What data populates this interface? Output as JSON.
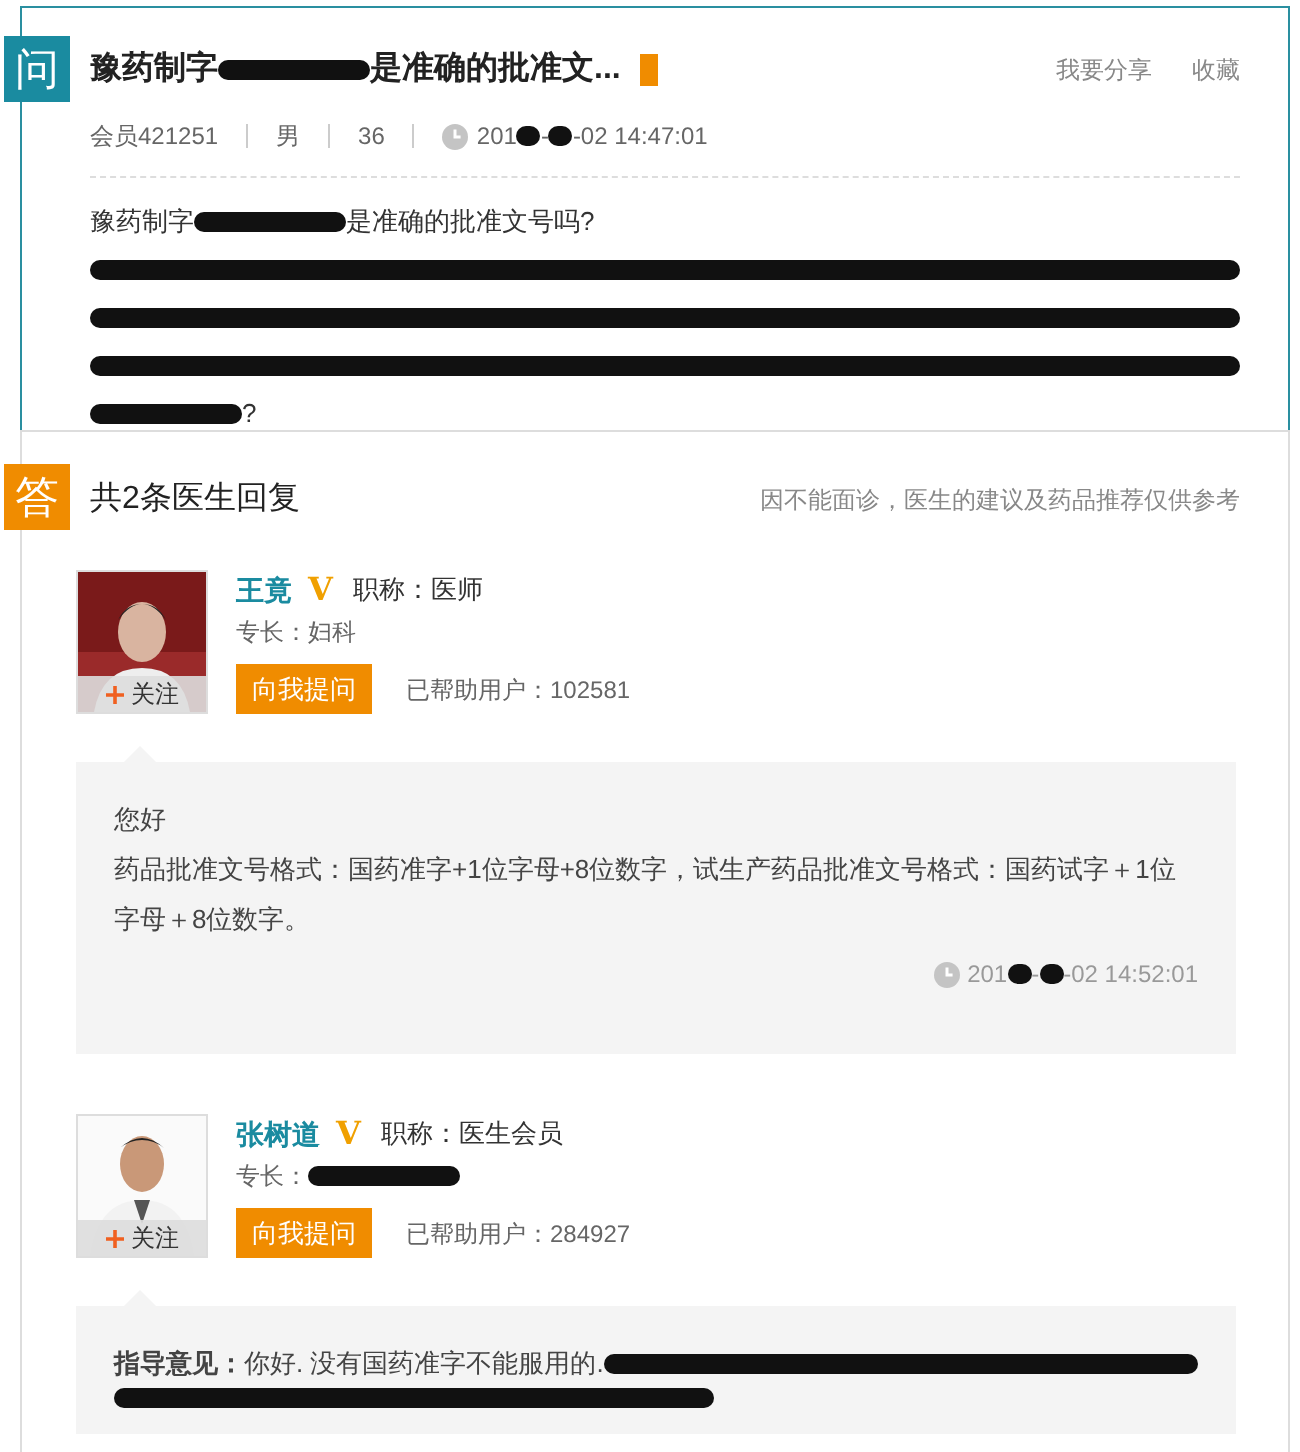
{
  "question": {
    "badge": "问",
    "title": [
      {
        "kind": "text",
        "text": "豫药制字"
      },
      {
        "kind": "scribble"
      },
      {
        "kind": "text",
        "text": "是准确的批准文..."
      }
    ],
    "actions": [
      "我要分享",
      "收藏"
    ],
    "meta": [
      "会员421251",
      "男",
      "36"
    ],
    "time": [
      {
        "kind": "text",
        "text": "201"
      },
      {
        "kind": "blot"
      },
      {
        "kind": "text",
        "text": "-"
      },
      {
        "kind": "blot"
      },
      {
        "kind": "text",
        "text": "-02 14:47:01"
      }
    ],
    "body": [
      [
        {
          "kind": "text",
          "text": "豫药制字"
        },
        {
          "kind": "scribble"
        },
        {
          "kind": "text",
          "text": "是准确的批准文号吗?"
        }
      ],
      [
        {
          "kind": "scribble_line"
        }
      ],
      [
        {
          "kind": "scribble_line"
        }
      ],
      [
        {
          "kind": "scribble_line"
        }
      ],
      [
        {
          "kind": "scribble"
        },
        {
          "kind": "text",
          "text": "?"
        }
      ]
    ]
  },
  "answers": {
    "badge": "答",
    "heading": "共2条医生回复",
    "note": "因不能面诊，医生的建议及药品推荐仅供参考",
    "doctors": [
      {
        "name": "王竟",
        "verified_mark": "V",
        "title": "职称：医师",
        "specialty": [
          {
            "kind": "text",
            "text": "专长：妇科"
          }
        ],
        "follow": "关注",
        "ask_button": "向我提问",
        "helped": "已帮助用户：102581",
        "reply": {
          "lines": [
            [
              {
                "kind": "text",
                "text": "您好"
              }
            ],
            [
              {
                "kind": "text",
                "text": "药品批准文号格式：国药准字+1位字母+8位数字，试生产药品批准文号格式：国药试字＋1位字母＋8位数字。"
              }
            ]
          ],
          "time": [
            {
              "kind": "text",
              "text": "201"
            },
            {
              "kind": "blot"
            },
            {
              "kind": "text",
              "text": "-"
            },
            {
              "kind": "blot"
            },
            {
              "kind": "text",
              "text": "-02 14:52:01"
            }
          ]
        }
      },
      {
        "name": "张树道",
        "verified_mark": "V",
        "title": "职称：医生会员",
        "specialty": [
          {
            "kind": "text",
            "text": "专长："
          },
          {
            "kind": "scribble"
          }
        ],
        "follow": "关注",
        "ask_button": "向我提问",
        "helped": "已帮助用户：284927",
        "reply": {
          "lines": [
            [
              {
                "kind": "label",
                "text": "指导意见："
              },
              {
                "kind": "text",
                "text": "你好. 没有国药准字不能服用的."
              },
              {
                "kind": "scribble_line"
              }
            ],
            [
              {
                "kind": "scribble_long"
              }
            ]
          ]
        }
      }
    ]
  }
}
